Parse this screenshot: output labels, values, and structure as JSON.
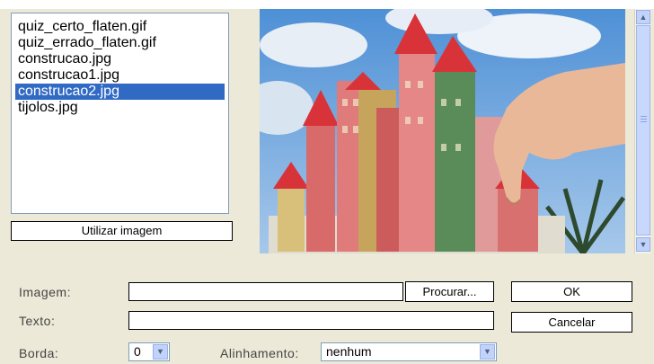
{
  "files": {
    "items": [
      "quiz_certo_flaten.gif",
      "quiz_errado_flaten.gif",
      "construcao.jpg",
      "construcao1.jpg",
      "construcao2.jpg",
      "tijolos.jpg"
    ],
    "selected_index": 4
  },
  "use_image_button": "Utilizar imagem",
  "preview": {
    "description_icon": "image-preview"
  },
  "form": {
    "image_label": "Imagem:",
    "image_value": "",
    "browse_button": "Procurar...",
    "text_label": "Texto:",
    "text_value": "",
    "border_label": "Borda:",
    "border_value": "0",
    "align_label": "Alinhamento:",
    "align_value": "nenhum"
  },
  "buttons": {
    "ok": "OK",
    "cancel": "Cancelar"
  },
  "colors": {
    "selection": "#316ac5",
    "dialog_bg": "#ece9d8",
    "sky": "#7fb2e0"
  }
}
